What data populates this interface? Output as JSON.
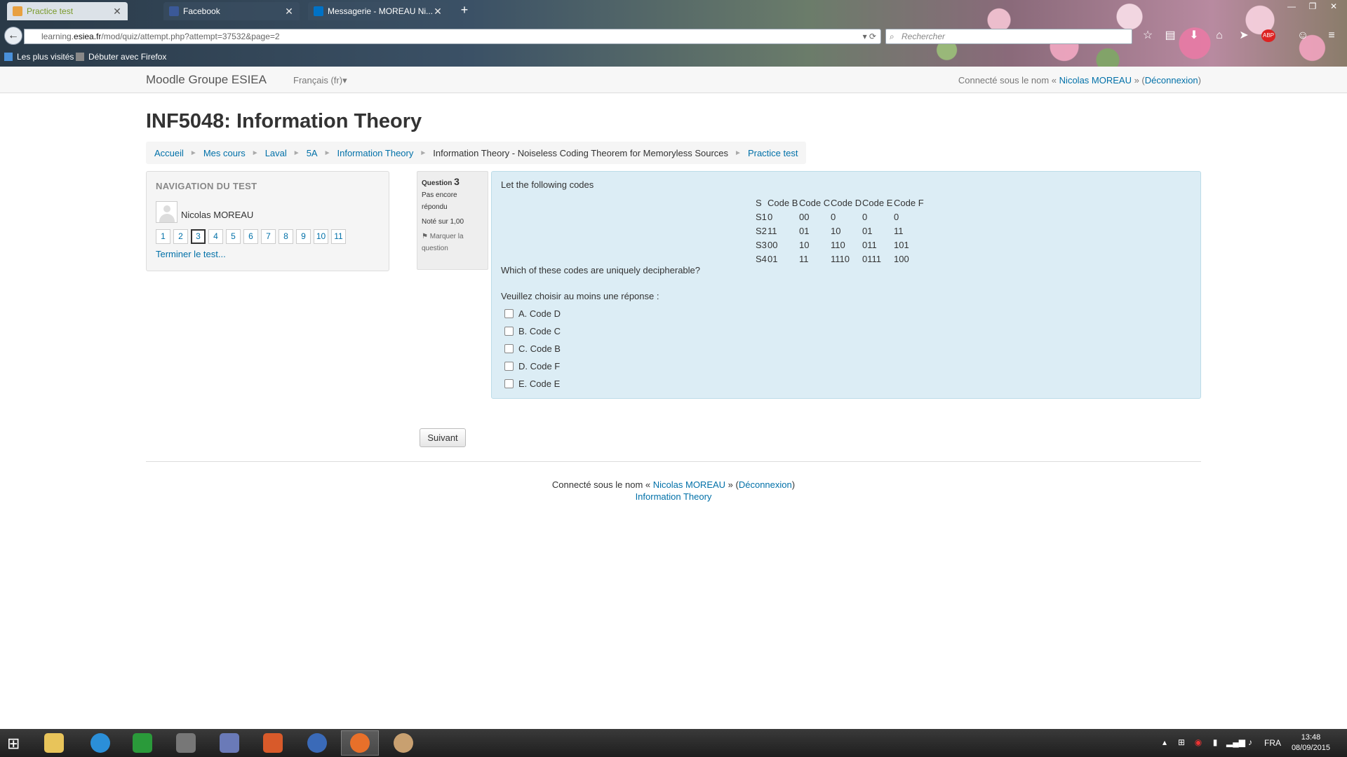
{
  "browser": {
    "tabs": [
      {
        "title": "Practice test",
        "active": true
      },
      {
        "title": "Facebook",
        "active": false
      },
      {
        "title": "Messagerie - MOREAU Ni...",
        "active": false
      }
    ],
    "new_tab": "+",
    "url_prefix": "learning.",
    "url_domain": "esiea.fr",
    "url_path": "/mod/quiz/attempt.php?attempt=37532&page=2",
    "search_placeholder": "Rechercher",
    "bookmarks": [
      "Les plus visités",
      "Débuter avec Firefox"
    ]
  },
  "moodle": {
    "site_name": "Moodle Groupe ESIEA",
    "language": "Français (fr)",
    "login": {
      "prefix": "Connecté sous le nom «",
      "user": "Nicolas MOREAU",
      "middle": "» (",
      "logout": "Déconnexion",
      "suffix": ")"
    },
    "page_title": "INF5048: Information Theory",
    "breadcrumb": [
      {
        "label": "Accueil",
        "link": true
      },
      {
        "label": "Mes cours",
        "link": true
      },
      {
        "label": "Laval",
        "link": true
      },
      {
        "label": "5A",
        "link": true
      },
      {
        "label": "Information Theory",
        "link": true
      },
      {
        "label": "Information Theory - Noiseless Coding Theorem for Memoryless Sources",
        "link": false
      },
      {
        "label": "Practice test",
        "link": true
      }
    ],
    "quiz_nav": {
      "title": "NAVIGATION DU TEST",
      "user_name": "Nicolas MOREAU",
      "questions": [
        "1",
        "2",
        "3",
        "4",
        "5",
        "6",
        "7",
        "8",
        "9",
        "10",
        "11"
      ],
      "current": "3",
      "finish_link": "Terminer le test..."
    },
    "question_info": {
      "label": "Question",
      "number": "3",
      "state": "Pas encore répondu",
      "grade": "Noté sur 1,00",
      "flag": "Marquer la question"
    },
    "question": {
      "intro": "Let the following codes",
      "table_header": [
        "S",
        "Code B",
        "Code C",
        "Code D",
        "Code E",
        "Code F"
      ],
      "table_rows": [
        [
          "S1",
          "0",
          "00",
          "0",
          "0",
          "0"
        ],
        [
          "S2",
          "11",
          "01",
          "10",
          "01",
          "11"
        ],
        [
          "S3",
          "00",
          "10",
          "110",
          "011",
          "101"
        ],
        [
          "S4",
          "01",
          "11",
          "1110",
          "0111",
          "100"
        ]
      ],
      "text": "Which of these codes are uniquely decipherable?",
      "prompt": "Veuillez choisir au moins une réponse :",
      "answers": [
        "A. Code D",
        "B. Code C",
        "C. Code B",
        "D. Code F",
        "E. Code E"
      ]
    },
    "next_button": "Suivant",
    "footer": {
      "prefix": "Connecté sous le nom «",
      "user": "Nicolas MOREAU",
      "middle": "» (",
      "logout": "Déconnexion",
      "suffix": ")",
      "course_link": "Information Theory"
    }
  },
  "taskbar": {
    "language": "FRA",
    "time": "13:48",
    "date": "08/09/2015"
  },
  "colors": {
    "link": "#0070a8",
    "question_bg": "#dcedf5",
    "active_tab_text": "#7a9a2a"
  }
}
